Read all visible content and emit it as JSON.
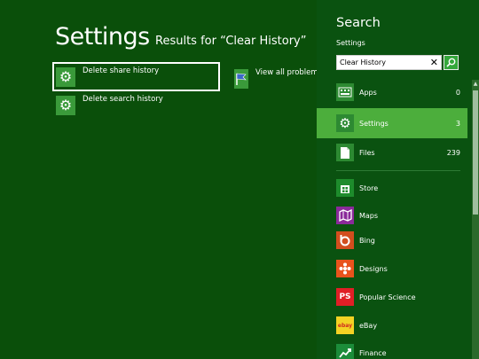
{
  "main": {
    "title": "Settings",
    "results_label": "Results for “Clear History”",
    "results": [
      {
        "label": "Delete share history",
        "icon": "gear-icon",
        "selected": true
      },
      {
        "label": "Delete search history",
        "icon": "gear-icon",
        "selected": false
      },
      {
        "label": "View all problem re",
        "icon": "flag-icon",
        "selected": false
      }
    ]
  },
  "search": {
    "title": "Search",
    "scope": "Settings",
    "query": "Clear History",
    "categories": [
      {
        "name": "Apps",
        "count": "0",
        "icon": "keyboard-icon"
      },
      {
        "name": "Settings",
        "count": "3",
        "icon": "gear-icon",
        "active": true
      },
      {
        "name": "Files",
        "count": "239",
        "icon": "file-icon"
      }
    ],
    "apps": [
      {
        "name": "Store",
        "icon": "store-icon",
        "color": "#1e8c2c"
      },
      {
        "name": "Maps",
        "icon": "map-icon",
        "color": "#8a2a9a"
      },
      {
        "name": "Bing",
        "icon": "bing-icon",
        "color": "#d24e1e"
      },
      {
        "name": "Designs",
        "icon": "designs-icon",
        "color": "#e8531c"
      },
      {
        "name": "Popular Science",
        "icon": "ps-icon",
        "color": "#e01f26",
        "tile_text": "PS"
      },
      {
        "name": "eBay",
        "icon": "ebay-icon",
        "color": "#f3d224",
        "tile_text": "ebay"
      },
      {
        "name": "Finance",
        "icon": "chart-icon",
        "color": "#1c8c3a"
      }
    ]
  },
  "colors": {
    "background": "#0a4f0a",
    "charm_background": "#0a5210",
    "active_highlight": "#4cae3c",
    "tile_green": "#3a9a3a"
  }
}
